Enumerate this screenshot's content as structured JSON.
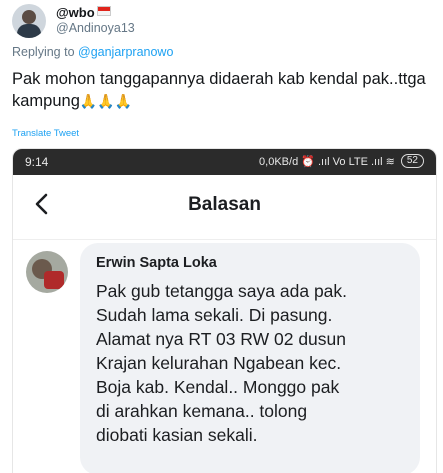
{
  "tweet": {
    "display_name": "@wbo",
    "handle": "@Andinoya13",
    "replying_prefix": "Replying to ",
    "replying_to": "@ganjarpranowo",
    "text": "Pak mohon tanggapannya didaerah kab kendal pak..ttga kampung",
    "emojis": "🙏🙏🙏",
    "translate_label": "Translate Tweet"
  },
  "phone": {
    "time": "9:14",
    "network": "0,0KB/d ⏰ .ııl Vo LTE .ııl ≋",
    "battery": "52",
    "screen_title": "Balasan",
    "message": {
      "sender": "Erwin Sapta Loka",
      "text": "Pak gub tetangga saya ada pak.\nSudah lama sekali. Di pasung.\nAlamat nya RT 03 RW 02 dusun\nKrajan kelurahan Ngabean kec.\nBoja kab. Kendal.. Monggo pak\ndi arahkan kemana.. tolong\ndiobati kasian sekali."
    }
  },
  "colors": {
    "link": "#1da1f2",
    "muted": "#657786",
    "bubble": "#f0f2f5"
  },
  "icons": {
    "back": "chevron-left-icon"
  }
}
